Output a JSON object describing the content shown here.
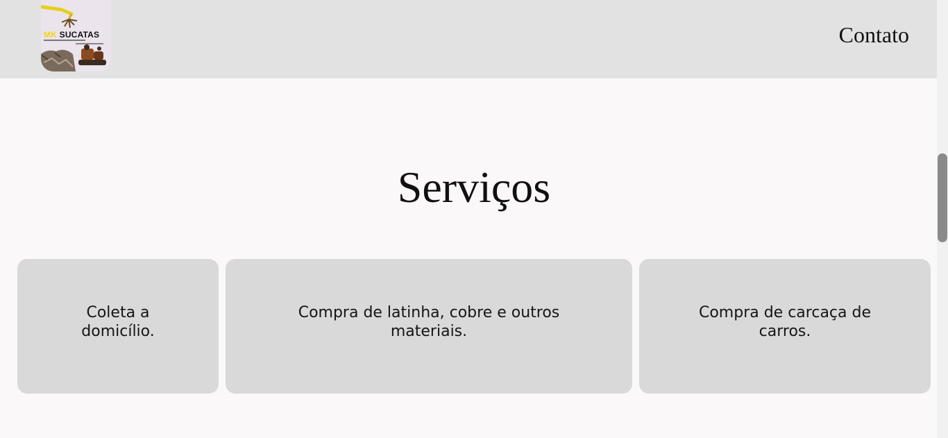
{
  "header": {
    "logo": {
      "brand_prefix": "MK",
      "brand_name": "SUCATAS",
      "icon": "scrap-metal-logo"
    },
    "nav": {
      "contact_label": "Contato"
    }
  },
  "services": {
    "title": "Serviços",
    "cards": [
      {
        "label": "Coleta a domicílio."
      },
      {
        "label": "Compra de latinha, cobre e outros materiais."
      },
      {
        "label": "Compra de carcaça de carros."
      }
    ]
  },
  "colors": {
    "header_bg": "#e2e2e2",
    "page_bg": "#faf8f9",
    "card_bg": "#d9d9d9",
    "logo_accent": "#f2d41a"
  }
}
